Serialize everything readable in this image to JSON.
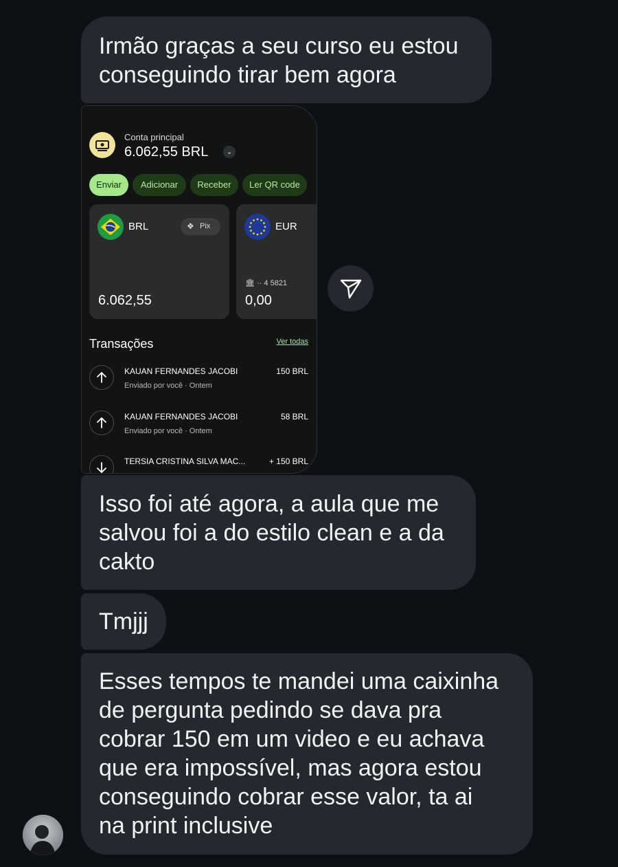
{
  "messages": [
    {
      "text": "Irmão graças a seu curso eu estou\nconseguindo tirar bem agora"
    },
    {
      "text": "Isso foi até agora, a aula que me\nsalvou foi a do estilo clean e a da\ncakto"
    },
    {
      "text": "Tmjjj"
    },
    {
      "text": "Esses tempos te mandei uma caixinha\nde pergunta pedindo se dava pra\ncobrar 150 em um video e eu achava\nque era impossível, mas agora estou\nconseguindo cobrar esse valor, ta ai\nna print inclusive"
    }
  ],
  "screenshot": {
    "account_label": "Conta principal",
    "balance": "6.062,55 BRL",
    "chevron": "⌄",
    "actions": [
      "Enviar",
      "Adicionar",
      "Receber",
      "Ler QR code"
    ],
    "cards": [
      {
        "code": "BRL",
        "amount": "6.062,55",
        "badge": "Pix",
        "badge_icon": "❖",
        "flag": "brazil-flag"
      },
      {
        "code": "EUR",
        "amount": "0,00",
        "account": "🏛 ·· 4 5821",
        "flag": "eu-flag"
      }
    ],
    "transactions_title": "Transações",
    "see_all": "Ver todas",
    "transactions": [
      {
        "name": "KAUAN FERNANDES JACOBI",
        "sub": "Enviado por você · Ontem",
        "amount": "150 BRL",
        "direction": "up"
      },
      {
        "name": "KAUAN FERNANDES JACOBI",
        "sub": "Enviado por você · Ontem",
        "amount": "58 BRL",
        "direction": "up"
      },
      {
        "name": "TERSIA CRISTINA SILVA MAC...",
        "sub": "",
        "amount": "+ 150 BRL",
        "direction": "down"
      }
    ]
  },
  "colors": {
    "background": "#0d1014",
    "bubble": "#25282e",
    "accent_green": "#a4e88a",
    "pill_dark": "#1f3a16"
  }
}
